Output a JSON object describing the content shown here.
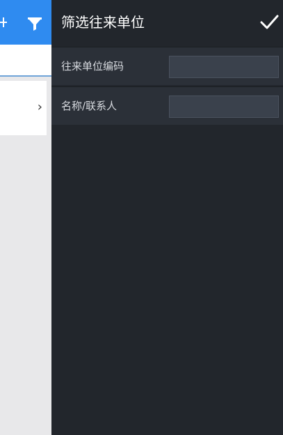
{
  "drawer": {
    "title": "筛选往来单位",
    "confirm_icon": "checkmark-icon",
    "fields": [
      {
        "label": "往来单位编码",
        "value": "",
        "placeholder": ""
      },
      {
        "label": "名称/联系人",
        "value": "",
        "placeholder": ""
      }
    ]
  },
  "background_page": {
    "header_icons": [
      "plus-icon",
      "filter-icon"
    ],
    "row_chevron": "›"
  },
  "colors": {
    "header_blue": "#2f8bf0",
    "drawer_bg": "#22262c",
    "field_row_bg": "#2b3038",
    "input_bg": "#3a414c"
  }
}
